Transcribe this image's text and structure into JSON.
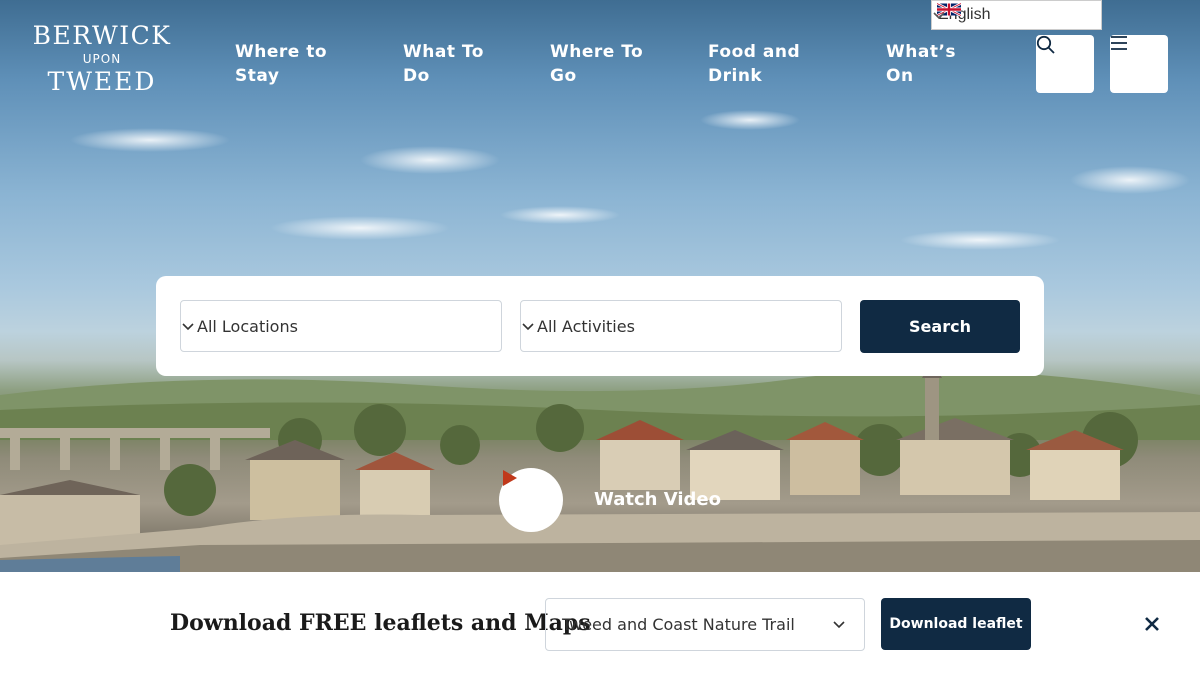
{
  "brand": {
    "line1": "BERWICK",
    "line2": "UPON",
    "line3": "TWEED"
  },
  "nav": {
    "items": [
      {
        "label": "Where to\nStay"
      },
      {
        "label": "What To\nDo"
      },
      {
        "label": "Where To\nGo"
      },
      {
        "label": "Food and\nDrink"
      },
      {
        "label": "What’s\nOn"
      }
    ]
  },
  "language": {
    "label": "English",
    "flag_icon": "uk-flag-icon",
    "dropdown_icon": "chevron-down-icon"
  },
  "header_icons": {
    "search": "search-icon",
    "menu": "hamburger-menu-icon"
  },
  "search_panel": {
    "location_value": "All Locations",
    "activity_value": "All Activities",
    "search_label": "Search"
  },
  "video": {
    "label": "Watch Video",
    "icon": "play-icon"
  },
  "leaflets": {
    "title": "Download FREE leaflets and Maps",
    "selected": "Tweed and Coast Nature Trail",
    "button_label": "Download leaflet",
    "close_icon": "close-icon"
  },
  "colors": {
    "primary": "#102a43",
    "play_icon": "#c0391b",
    "white": "#ffffff"
  }
}
